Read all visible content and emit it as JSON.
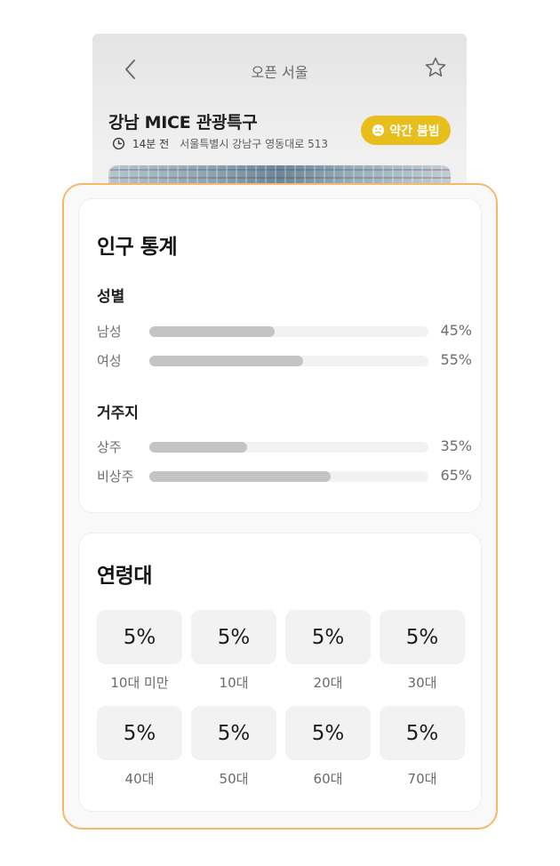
{
  "header": {
    "title": "오픈 서울",
    "back_icon": "chevron-left-icon",
    "favorite_icon": "star-outline-icon"
  },
  "place": {
    "name": "강남 MICE 관광특구",
    "updated": "14분 전",
    "address": "서울특별시 강남구 영동대로 513",
    "congestion_label": "약간 붐빔",
    "congestion_color": "#e8be1c",
    "congestion_icon": "sad-face-icon",
    "clock_icon": "clock-icon"
  },
  "demographics": {
    "title": "인구 통계",
    "gender": {
      "title": "성별",
      "rows": [
        {
          "label": "남성",
          "percent": 45,
          "value": "45%"
        },
        {
          "label": "여성",
          "percent": 55,
          "value": "55%"
        }
      ]
    },
    "residence": {
      "title": "거주지",
      "rows": [
        {
          "label": "상주",
          "percent": 35,
          "value": "35%"
        },
        {
          "label": "비상주",
          "percent": 65,
          "value": "65%"
        }
      ]
    }
  },
  "age": {
    "title": "연령대",
    "groups": [
      {
        "value": "5%",
        "label": "10대 미만"
      },
      {
        "value": "5%",
        "label": "10대"
      },
      {
        "value": "5%",
        "label": "20대"
      },
      {
        "value": "5%",
        "label": "30대"
      },
      {
        "value": "5%",
        "label": "40대"
      },
      {
        "value": "5%",
        "label": "50대"
      },
      {
        "value": "5%",
        "label": "60대"
      },
      {
        "value": "5%",
        "label": "70대"
      }
    ]
  },
  "colors": {
    "highlight_border": "#f5b96b",
    "bar_fill": "#c4c4c6",
    "bar_track": "#f2f2f2"
  }
}
